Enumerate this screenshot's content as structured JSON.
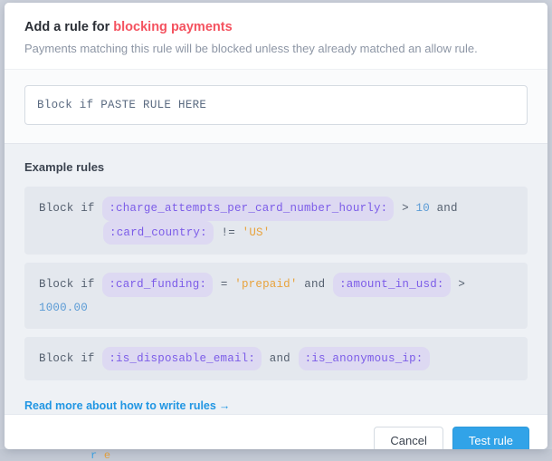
{
  "colors": {
    "accent_red": "#f4525f",
    "link_blue": "#2196e3",
    "primary_button": "#31a3e8",
    "token_purple": "#7c5ce8",
    "token_pill_bg": "#ddd9f2",
    "string_orange": "#e8a33d",
    "number_blue": "#5b9bd5",
    "panel_bg": "#eef1f5",
    "card_bg": "#e4e8ee",
    "page_backdrop": "#cdd2dc"
  },
  "header": {
    "title_prefix": "Add a rule for ",
    "title_accent": "blocking payments",
    "subtitle": "Payments matching this rule will be blocked unless they already matched an allow rule."
  },
  "rule_input": {
    "value": "Block if PASTE RULE HERE",
    "placeholder": "Block if ..."
  },
  "examples": {
    "heading": "Example rules",
    "rules": [
      {
        "lines": [
          [
            {
              "type": "kw",
              "text": "Block if"
            },
            {
              "type": "pill",
              "text": ":charge_attempts_per_card_number_hourly:"
            },
            {
              "type": "op",
              "text": ">"
            },
            {
              "type": "num",
              "text": "10"
            },
            {
              "type": "kw",
              "text": "and"
            }
          ],
          [
            {
              "type": "pill",
              "text": ":card_country:"
            },
            {
              "type": "op",
              "text": "!="
            },
            {
              "type": "str",
              "text": "'US'"
            }
          ]
        ]
      },
      {
        "lines": [
          [
            {
              "type": "kw",
              "text": "Block if"
            },
            {
              "type": "pill",
              "text": ":card_funding:"
            },
            {
              "type": "op",
              "text": "="
            },
            {
              "type": "str",
              "text": "'prepaid'"
            },
            {
              "type": "kw",
              "text": "and"
            },
            {
              "type": "pill",
              "text": ":amount_in_usd:"
            },
            {
              "type": "op",
              "text": ">"
            },
            {
              "type": "num",
              "text": "1000.00"
            }
          ]
        ]
      },
      {
        "lines": [
          [
            {
              "type": "kw",
              "text": "Block if"
            },
            {
              "type": "pill",
              "text": ":is_disposable_email:"
            },
            {
              "type": "kw",
              "text": "and"
            },
            {
              "type": "pill",
              "text": ":is_anonymous_ip:"
            }
          ]
        ]
      }
    ],
    "read_more_label": "Read more about how to write rules",
    "read_more_arrow": "→"
  },
  "footer": {
    "cancel_label": "Cancel",
    "submit_label": "Test rule"
  }
}
